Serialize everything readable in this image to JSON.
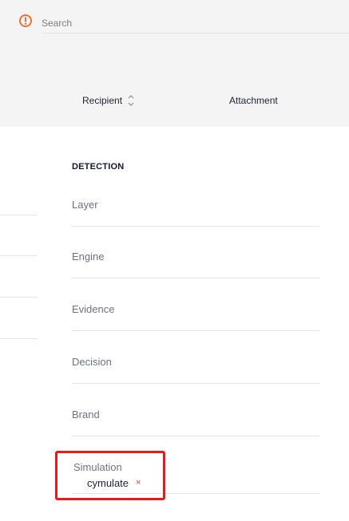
{
  "header": {
    "info_icon": "info-circle-icon",
    "search_placeholder": "Search",
    "columns": {
      "recipient": "Recipient",
      "attachment": "Attachment"
    },
    "sort_icon": "sort-chevrons-icon"
  },
  "detection": {
    "title": "DETECTION",
    "filters": {
      "layer": "Layer",
      "engine": "Engine",
      "evidence": "Evidence",
      "decision": "Decision",
      "brand": "Brand"
    },
    "simulation": {
      "label": "Simulation",
      "chip_value": "cymulate",
      "chip_remove": "×"
    }
  },
  "colors": {
    "accent_orange": "#f06425",
    "highlight_red": "#e41c1c",
    "remove_red": "#e0403a",
    "header_bg": "#f4f4f4"
  }
}
